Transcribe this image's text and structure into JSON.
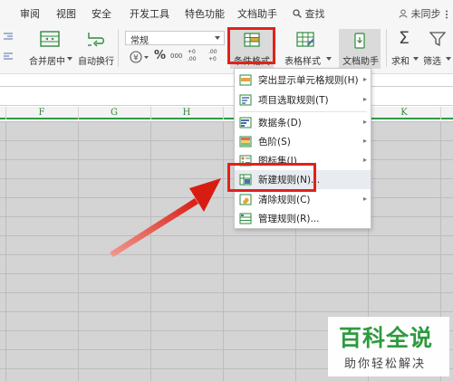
{
  "menubar": {
    "tabs": [
      "审阅",
      "视图",
      "安全",
      "开发工具",
      "特色功能",
      "文档助手"
    ],
    "search_label": "查找",
    "user_label": "未同步"
  },
  "ribbon": {
    "merge_center_label": "合并居中",
    "wrap_text_label": "自动换行",
    "number_format_value": "常规",
    "percent_symbol": "%",
    "thousands_symbol": "000",
    "decimal_add_symbol": "+0 .00",
    "decimal_remove_symbol": ".00 +0",
    "conditional_format_label": "条件格式",
    "table_style_label": "表格样式",
    "doc_assistant_label": "文档助手",
    "sum_label": "求和",
    "filter_label": "筛选"
  },
  "columns": [
    "F",
    "G",
    "H",
    "K"
  ],
  "menu": {
    "items": [
      {
        "label": "突出显示单元格规则(H)",
        "icon": "highlight-rules-icon",
        "submenu": true
      },
      {
        "label": "项目选取规则(T)",
        "icon": "top-bottom-rules-icon",
        "submenu": true
      },
      {
        "label": "数据条(D)",
        "icon": "data-bars-icon",
        "submenu": true
      },
      {
        "label": "色阶(S)",
        "icon": "color-scale-icon",
        "submenu": true
      },
      {
        "label": "图标集(I)",
        "icon": "icon-sets-icon",
        "submenu": true
      },
      {
        "label": "新建规则(N)...",
        "icon": "new-rule-icon",
        "submenu": false
      },
      {
        "label": "清除规则(C)",
        "icon": "clear-rules-icon",
        "submenu": true
      },
      {
        "label": "管理规则(R)...",
        "icon": "manage-rules-icon",
        "submenu": false
      }
    ]
  },
  "watermark": {
    "brand": "百科全说",
    "tagline": "助你轻松解决"
  },
  "colors": {
    "highlight": "#e0221b",
    "accent_green": "#2f9a46",
    "grid_fill": "#d4d4d4"
  }
}
